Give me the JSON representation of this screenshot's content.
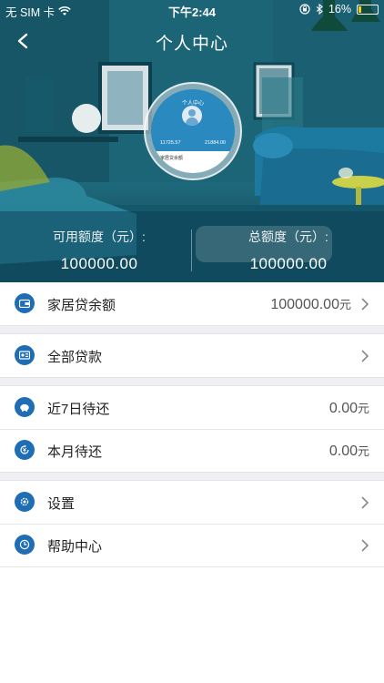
{
  "status_bar": {
    "carrier": "无 SIM 卡",
    "time": "下午2:44",
    "battery": "16%",
    "battery_fraction": 0.16
  },
  "nav": {
    "title": "个人中心",
    "back_icon": "chevron-left-icon"
  },
  "preview": {
    "title": "个人中心",
    "left_value": "11725.57",
    "right_value": "21884.00",
    "card_label": "家居贷余额"
  },
  "quota": {
    "available_label": "可用额度（元）:",
    "available_value": "100000.00",
    "total_label": "总额度（元）:",
    "total_value": "100000.00"
  },
  "menu": {
    "home_loan": {
      "label": "家居贷余额",
      "value": "100000.00",
      "unit": "元",
      "icon": "wallet-icon"
    },
    "all_loans": {
      "label": "全部贷款",
      "icon": "loan-list-icon"
    },
    "due_7_days": {
      "label": "近7日待还",
      "value": "0.00",
      "unit": "元",
      "icon": "piggy-bank-icon"
    },
    "due_month": {
      "label": "本月待还",
      "value": "0.00",
      "unit": "元",
      "icon": "yuan-cycle-icon"
    },
    "settings": {
      "label": "设置",
      "icon": "gear-icon"
    },
    "help": {
      "label": "帮助中心",
      "icon": "clock-icon"
    }
  },
  "colors": {
    "accent": "#1f6db5",
    "hero_dark": "#0f4a5c",
    "hero_mid": "#1f7588"
  }
}
